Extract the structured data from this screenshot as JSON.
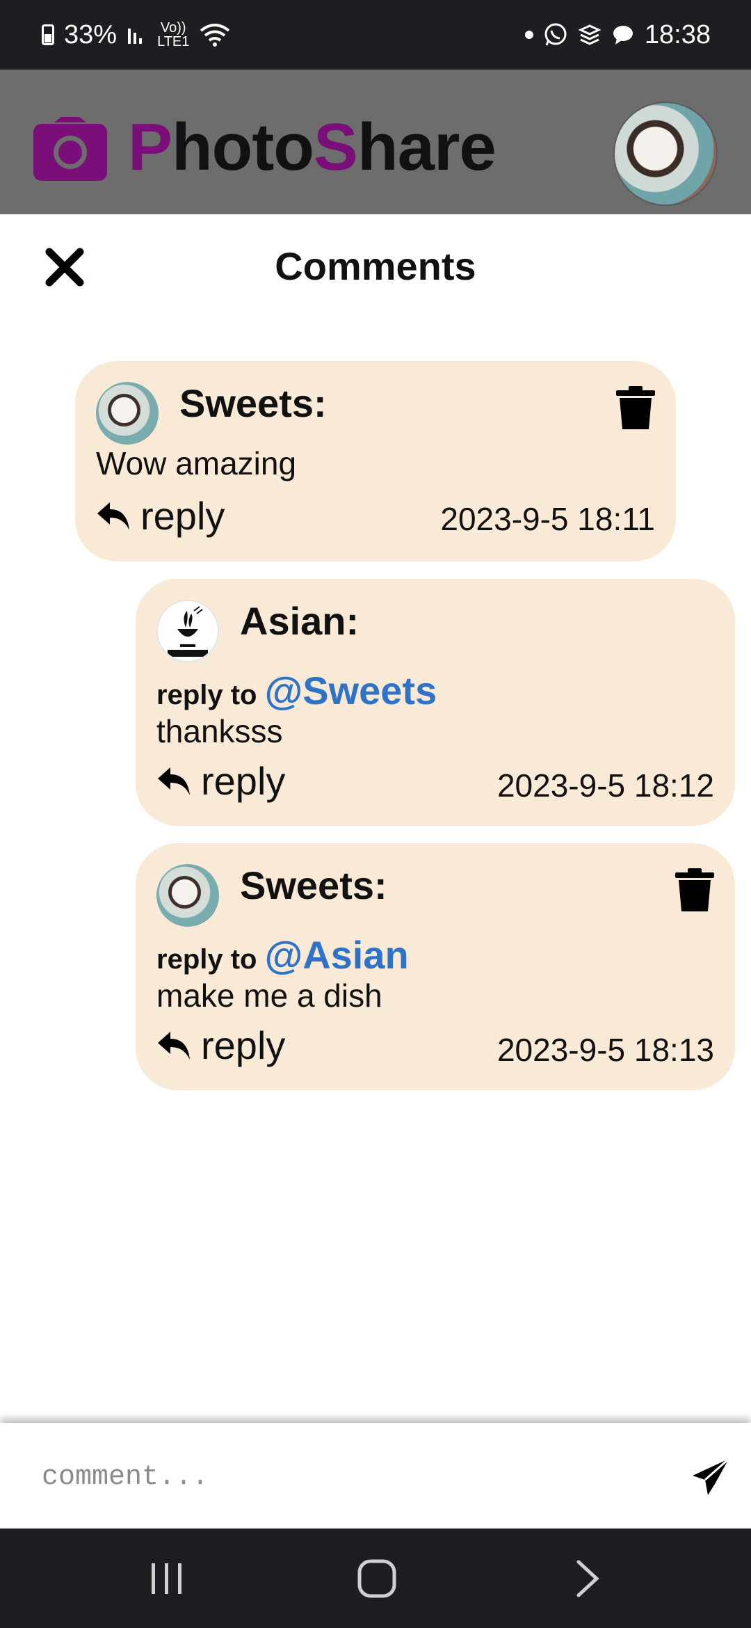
{
  "status_bar": {
    "battery": "33%",
    "network_top": "Vo))",
    "network_bottom": "LTE1",
    "time": "18:38",
    "icons": [
      "battery-icon",
      "signal-icon",
      "volte-icon",
      "wifi-icon",
      "dot-icon",
      "whatsapp-icon",
      "layers-icon",
      "message-icon"
    ]
  },
  "header": {
    "brand_accent_1": "P",
    "brand_part_1": "hoto",
    "brand_accent_2": "S",
    "brand_part_2": "hare",
    "brand_color": "#7a0f7a"
  },
  "panel": {
    "title": "Comments"
  },
  "comments": [
    {
      "author": "Sweets:",
      "text": "Wow amazing",
      "reply_label": "reply",
      "time": "2023-9-5 18:11",
      "deletable": true
    },
    {
      "author": "Asian:",
      "reply_to_label": "reply to",
      "mention": "@Sweets",
      "text": "thanksss",
      "reply_label": "reply",
      "time": "2023-9-5 18:12",
      "deletable": false
    },
    {
      "author": "Sweets:",
      "reply_to_label": "reply to",
      "mention": "@Asian",
      "text": "make me a dish",
      "reply_label": "reply",
      "time": "2023-9-5 18:13",
      "deletable": true
    }
  ],
  "input": {
    "placeholder": "comment..."
  },
  "colors": {
    "comment_bg": "#f9ead8",
    "mention": "#2f73c8",
    "header_bg": "#6d6d6d"
  }
}
